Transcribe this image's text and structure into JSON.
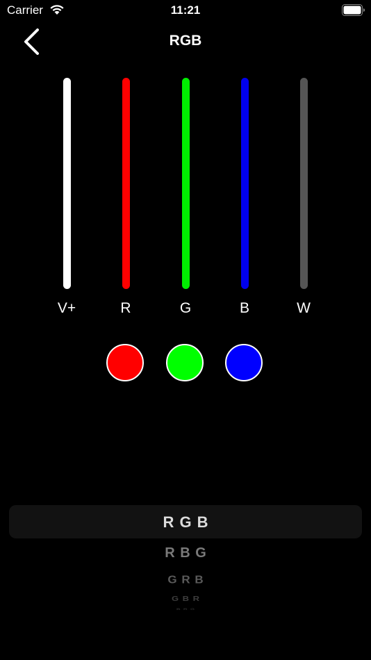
{
  "status_bar": {
    "carrier": "Carrier",
    "time": "11:21"
  },
  "nav": {
    "title": "RGB"
  },
  "channels": [
    {
      "label": "V+",
      "color": "#ffffff"
    },
    {
      "label": "R",
      "color": "#ff0000"
    },
    {
      "label": "G",
      "color": "#00ee00"
    },
    {
      "label": "B",
      "color": "#0000ee"
    },
    {
      "label": "W",
      "color": "#555555"
    }
  ],
  "color_buttons": [
    {
      "name": "red",
      "color": "#ff0000"
    },
    {
      "name": "green",
      "color": "#00ff00"
    },
    {
      "name": "blue",
      "color": "#0000ff"
    }
  ],
  "picker": {
    "options": [
      "R G B",
      "R B G",
      "G R B",
      "G B R",
      "B R G"
    ],
    "selected_index": 0
  }
}
